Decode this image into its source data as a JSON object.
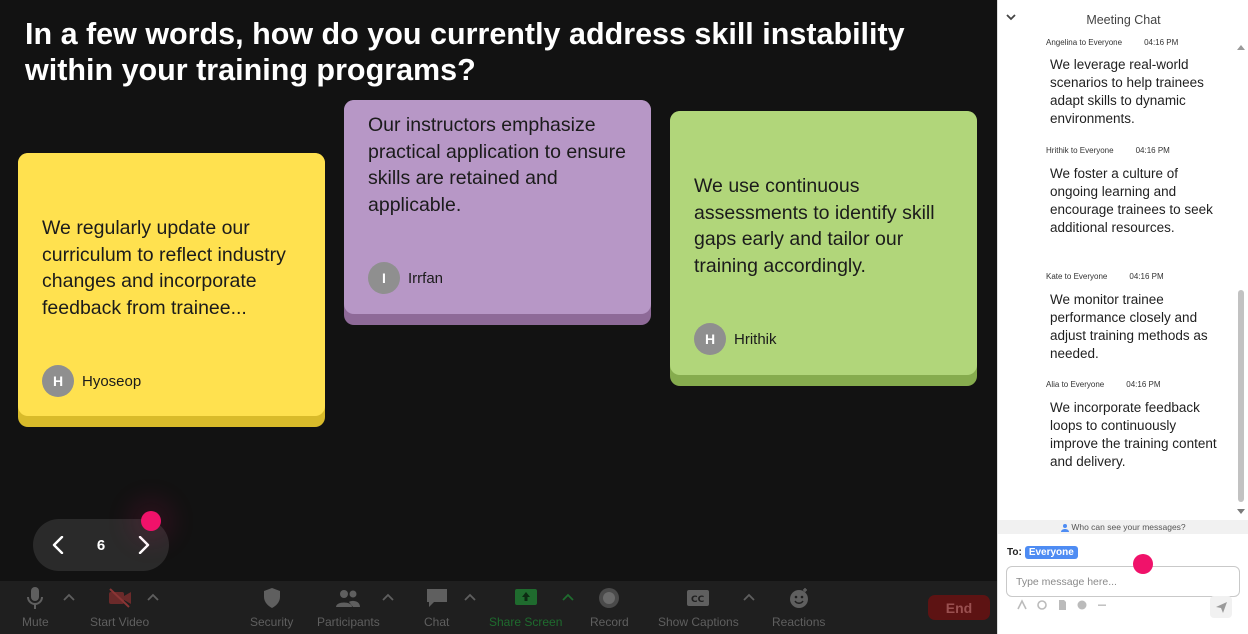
{
  "question": "In a few words, how do you currently address skill instability within your training programs?",
  "cards": [
    {
      "text": "We regularly update our curriculum to reflect industry changes and incorporate feedback from trainee...",
      "initial": "H",
      "author": "Hyoseop",
      "color": "#ffe14f"
    },
    {
      "text": "Our instructors emphasize practical application to ensure skills are retained and applicable.",
      "initial": "I",
      "author": "Irrfan",
      "color": "#b797c6"
    },
    {
      "text": "We use continuous assessments to identify skill gaps early and tailor our training accordingly.",
      "initial": "H",
      "author": "Hrithik",
      "color": "#b1d67a"
    }
  ],
  "pager": {
    "page": "6"
  },
  "toolbar": {
    "mute": "Mute",
    "start_video": "Start Video",
    "security": "Security",
    "participants": "Participants",
    "chat": "Chat",
    "share_screen": "Share Screen",
    "record": "Record",
    "show_captions": "Show Captions",
    "reactions": "Reactions",
    "end": "End"
  },
  "chat": {
    "title": "Meeting Chat",
    "messages": [
      {
        "sender": "Angelina to Everyone",
        "time": "04:16 PM",
        "text": "We leverage real-world scenarios to help trainees adapt skills to dynamic environments."
      },
      {
        "sender": "Hrithik to Everyone",
        "time": "04:16 PM",
        "text": "We foster a culture of ongoing learning and encourage trainees to seek additional resources."
      },
      {
        "sender": "Kate to Everyone",
        "time": "04:16 PM",
        "text": "We monitor trainee performance closely and adjust training methods as needed."
      },
      {
        "sender": "Alia to Everyone",
        "time": "04:16 PM",
        "text": "We incorporate feedback loops to continuously improve the training content and delivery."
      }
    ],
    "who_can_see": "Who can see your messages?",
    "to_label": "To:",
    "to_value": "Everyone",
    "input_placeholder": "Type message here..."
  },
  "colors": {
    "accent_pink": "#f0126a",
    "chip_blue": "#4e8cf3",
    "end_red": "#5d1313",
    "share_green": "#2ea043"
  }
}
